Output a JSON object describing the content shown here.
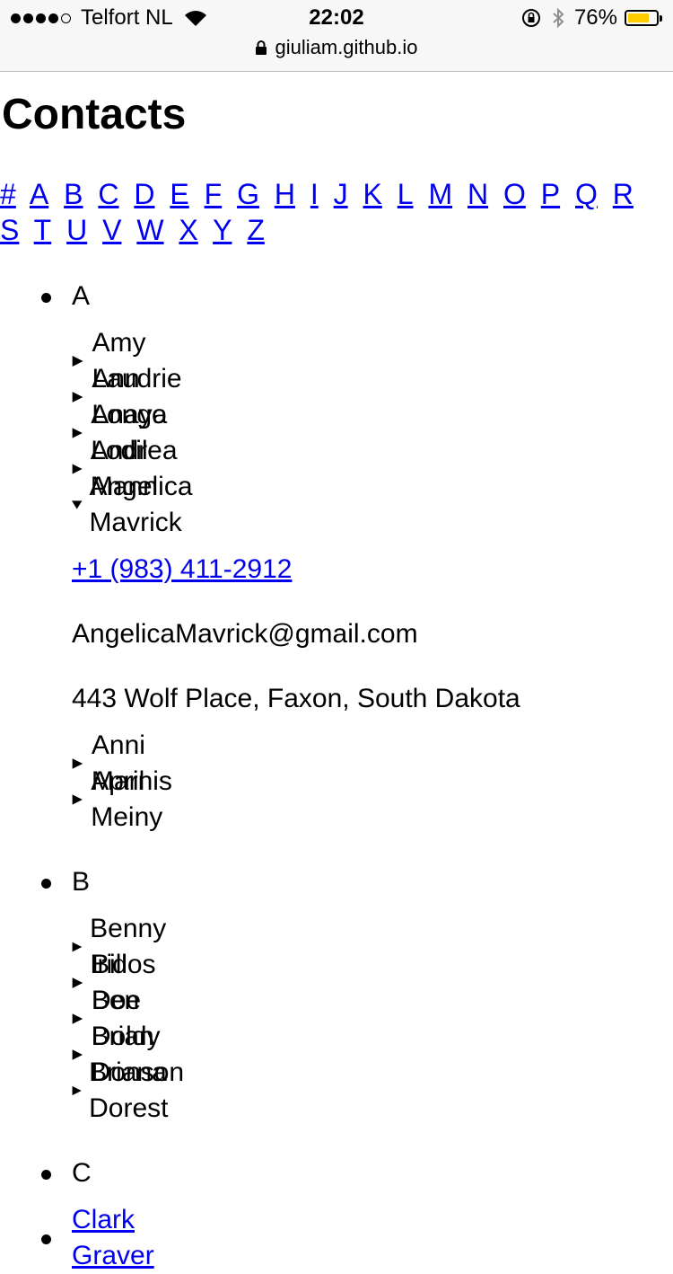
{
  "status": {
    "carrier": "Telfort NL",
    "time": "22:02",
    "battery_pct": "76%",
    "battery_level": 0.76,
    "battery_color": "#ffcc00"
  },
  "url": "giuliam.github.io",
  "page": {
    "title": "Contacts",
    "alphabet": [
      "#",
      "A",
      "B",
      "C",
      "D",
      "E",
      "F",
      "G",
      "H",
      "I",
      "J",
      "K",
      "L",
      "M",
      "N",
      "O",
      "P",
      "Q",
      "R",
      "S",
      "T",
      "U",
      "V",
      "W",
      "X",
      "Y",
      "Z"
    ],
    "link_color": "#0000ee"
  },
  "groups": [
    {
      "letter": "A",
      "contacts": [
        {
          "name": "Amy Laudrie",
          "expanded": false
        },
        {
          "name": "Ann Longo",
          "expanded": false
        },
        {
          "name": "Anaya Lodil",
          "expanded": false
        },
        {
          "name": "Andrea Mann",
          "expanded": false
        },
        {
          "name": "Angelica Mavrick",
          "expanded": true,
          "phone": "+1 (983) 411-2912",
          "email": "AngelicaMavrick@gmail.com",
          "address": "443 Wolf Place, Faxon, South Dakota"
        },
        {
          "name": "Anni Marnis",
          "expanded": false
        },
        {
          "name": "April Meiny",
          "expanded": false
        }
      ]
    },
    {
      "letter": "B",
      "contacts": [
        {
          "name": "Benny Iridos",
          "expanded": false
        },
        {
          "name": "Bill Doe",
          "expanded": false
        },
        {
          "name": "Ben Doldy",
          "expanded": false
        },
        {
          "name": "Brian Donson",
          "expanded": false
        },
        {
          "name": "Briana Dorest",
          "expanded": false
        }
      ]
    },
    {
      "letter": "C",
      "partial_link": "Clark Graver"
    }
  ]
}
